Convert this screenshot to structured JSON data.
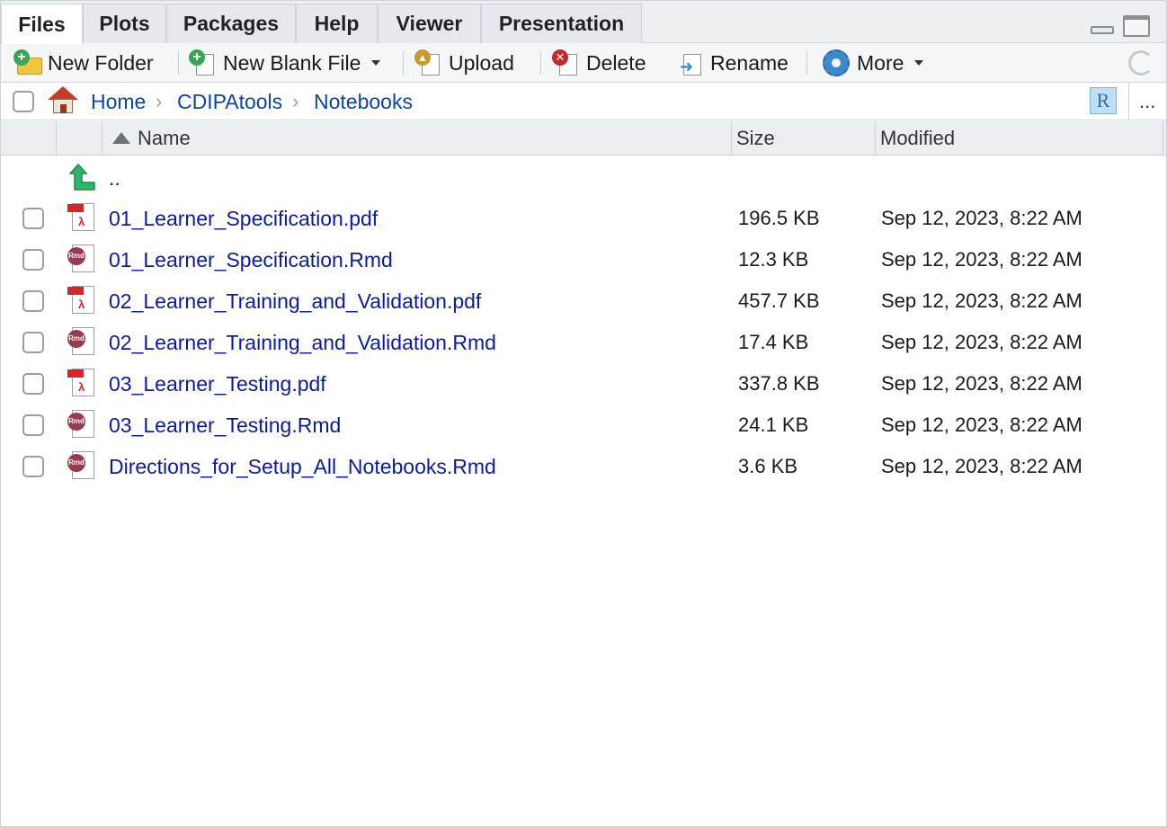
{
  "tabs": [
    {
      "label": "Files",
      "active": true
    },
    {
      "label": "Plots",
      "active": false
    },
    {
      "label": "Packages",
      "active": false
    },
    {
      "label": "Help",
      "active": false
    },
    {
      "label": "Viewer",
      "active": false
    },
    {
      "label": "Presentation",
      "active": false
    }
  ],
  "toolbar": {
    "new_folder": "New Folder",
    "new_blank_file": "New Blank File",
    "upload": "Upload",
    "delete": "Delete",
    "rename": "Rename",
    "more": "More"
  },
  "breadcrumb": [
    "Home",
    "CDIPAtools",
    "Notebooks"
  ],
  "more_options": "...",
  "columns": {
    "name": "Name",
    "size": "Size",
    "modified": "Modified"
  },
  "parent_dir": "..",
  "files": [
    {
      "name": "01_Learner_Specification.pdf",
      "size": "196.5 KB",
      "modified": "Sep 12, 2023, 8:22 AM",
      "type": "pdf"
    },
    {
      "name": "01_Learner_Specification.Rmd",
      "size": "12.3 KB",
      "modified": "Sep 12, 2023, 8:22 AM",
      "type": "rmd"
    },
    {
      "name": "02_Learner_Training_and_Validation.pdf",
      "size": "457.7 KB",
      "modified": "Sep 12, 2023, 8:22 AM",
      "type": "pdf"
    },
    {
      "name": "02_Learner_Training_and_Validation.Rmd",
      "size": "17.4 KB",
      "modified": "Sep 12, 2023, 8:22 AM",
      "type": "rmd"
    },
    {
      "name": "03_Learner_Testing.pdf",
      "size": "337.8 KB",
      "modified": "Sep 12, 2023, 8:22 AM",
      "type": "pdf"
    },
    {
      "name": "03_Learner_Testing.Rmd",
      "size": "24.1 KB",
      "modified": "Sep 12, 2023, 8:22 AM",
      "type": "rmd"
    },
    {
      "name": "Directions_for_Setup_All_Notebooks.Rmd",
      "size": "3.6 KB",
      "modified": "Sep 12, 2023, 8:22 AM",
      "type": "rmd"
    }
  ],
  "icon_text": {
    "rmd": "Rmd",
    "rproj": "R"
  },
  "colors": {
    "link": "#0b1ba1",
    "breadcrumb": "#0b44a8",
    "pdf": "#d6252a",
    "rmd": "#9b3a4e"
  }
}
